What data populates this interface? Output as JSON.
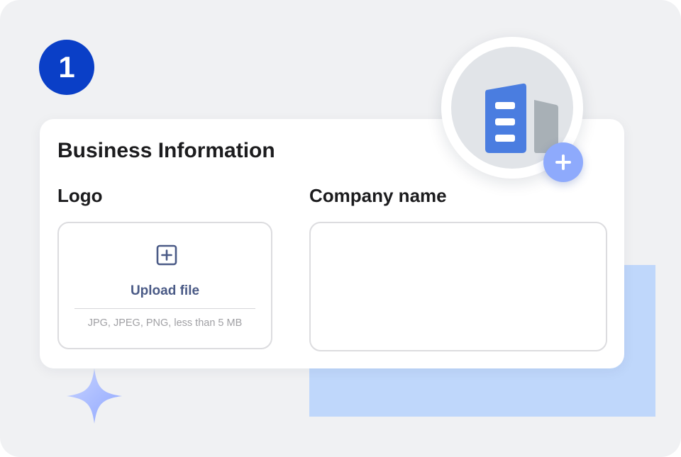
{
  "step": {
    "number": "1"
  },
  "card": {
    "title": "Business Information",
    "logo": {
      "label": "Logo",
      "upload_label": "Upload file",
      "hint": "JPG, JPEG, PNG, less than 5 MB"
    },
    "company": {
      "label": "Company name",
      "value": ""
    }
  },
  "icons": {
    "upload": "plus-square-icon",
    "building": "building-icon",
    "add": "plus-icon",
    "sparkle": "sparkle-icon"
  },
  "colors": {
    "background": "#f0f1f3",
    "step_badge": "#0a3fc7",
    "accent_text": "#4a5a86",
    "building_primary": "#4a7de0",
    "building_secondary": "#a8b0b6",
    "add_button": "#8eaafc",
    "decor_rect": "#bfd7fb"
  }
}
